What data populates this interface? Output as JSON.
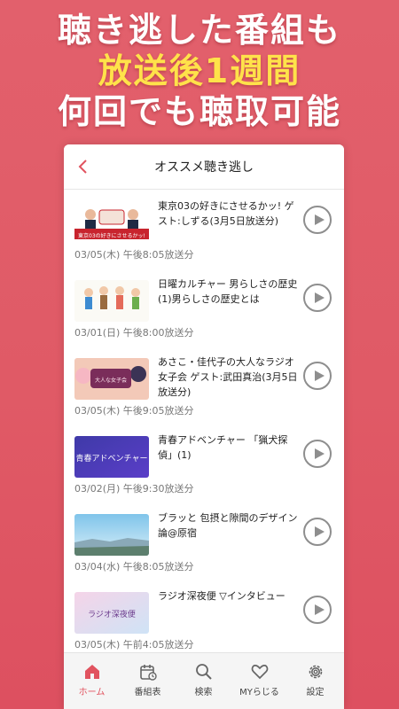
{
  "promo": {
    "line1": "聴き逃した番組も",
    "line2": "放送後1週間",
    "line3": "何回でも聴取可能"
  },
  "header": {
    "back_icon": "chevron-left-icon",
    "title": "オススメ聴き逃し"
  },
  "items": [
    {
      "title": "東京03の好きにさせるかッ! ゲスト:しずる(3月5日放送分)",
      "date": "03/05(木) 午後8:05放送分",
      "thumb_text": "東京03の好きにさせるかッ!"
    },
    {
      "title": "日曜カルチャー 男らしさの歴史 (1)男らしさの歴史とは",
      "date": "03/01(日) 午後8:00放送分",
      "thumb_text": ""
    },
    {
      "title": "あさこ・佳代子の大人なラジオ女子会 ゲスト:武田真治(3月5日放送分)",
      "date": "03/05(木) 午後9:05放送分",
      "thumb_text": "大人な女子会"
    },
    {
      "title": "青春アドベンチャー 「猟犬探偵」(1)",
      "date": "03/02(月) 午後9:30放送分",
      "thumb_text": "青春アドベンチャー"
    },
    {
      "title": "ブラッと 包摂と隙間のデザイン論@原宿",
      "date": "03/04(水) 午後8:05放送分",
      "thumb_text": ""
    },
    {
      "title": "ラジオ深夜便 ▽インタビュー",
      "date": "03/05(木) 午前4:05放送分",
      "thumb_text": "ラジオ深夜便"
    }
  ],
  "tabs": [
    {
      "label": "ホーム",
      "icon": "home-icon",
      "active": true
    },
    {
      "label": "番組表",
      "icon": "calendar-icon",
      "active": false
    },
    {
      "label": "検索",
      "icon": "search-icon",
      "active": false
    },
    {
      "label": "MYらじる",
      "icon": "heart-icon",
      "active": false
    },
    {
      "label": "設定",
      "icon": "gear-icon",
      "active": false
    }
  ],
  "colors": {
    "background": "#e05a66",
    "accent": "#e1535f",
    "highlight_text": "#ffe24a"
  }
}
